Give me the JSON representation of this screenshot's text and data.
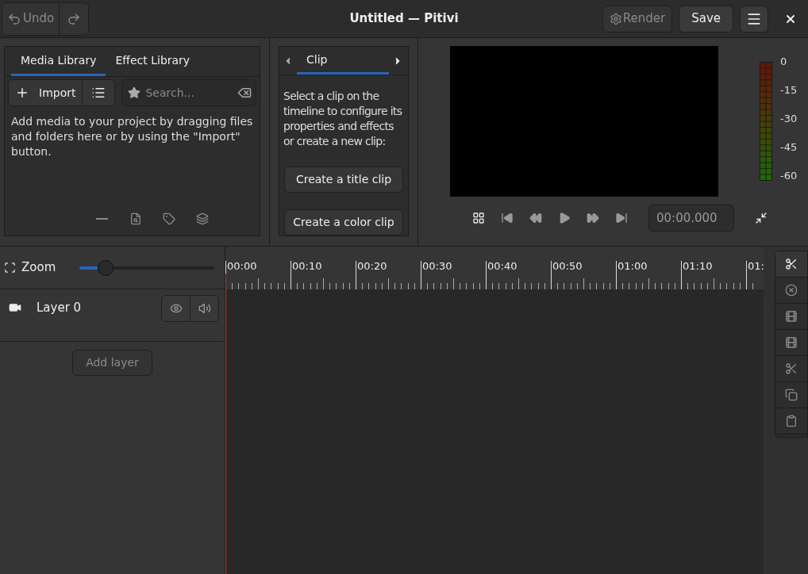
{
  "header": {
    "undo": {
      "label": "Undo",
      "disabled": true
    },
    "redo": {
      "disabled": true
    },
    "title": "Untitled — Pitivi",
    "render": {
      "label": "Render",
      "disabled": true
    },
    "save": {
      "label": "Save"
    }
  },
  "library": {
    "tabs": [
      {
        "label": "Media Library",
        "selected": true
      },
      {
        "label": "Effect Library",
        "selected": false
      }
    ],
    "import": "Import",
    "search": {
      "placeholder": "Search..."
    },
    "hint": "Add media to your project by dragging files and folders here or by using the \"Import\" button.",
    "actions": [
      {
        "kind": "remove",
        "disabled": true
      },
      {
        "kind": "preview",
        "disabled": true
      },
      {
        "kind": "tag",
        "disabled": true
      },
      {
        "kind": "proxy",
        "disabled": true
      }
    ]
  },
  "clip_panel": {
    "tabs": [
      {
        "label": "Clip",
        "selected": true
      }
    ],
    "hint": "Select a clip on the timeline to configure its properties and effects or create a new clip:",
    "buttons": [
      "Create a title clip",
      "Create a color clip"
    ]
  },
  "viewer": {
    "meter_labels": [
      "0",
      "-15",
      "-30",
      "-45",
      "-60"
    ],
    "timecode": "00:00.000"
  },
  "timeline": {
    "zoom": {
      "label": "Zoom",
      "level": 0.19
    },
    "ruler": [
      "00:00",
      "00:10",
      "00:20",
      "00:30",
      "00:40",
      "00:50",
      "01:00",
      "01:10",
      "01:"
    ],
    "layers": [
      {
        "name": "Layer 0"
      }
    ],
    "add_layer": {
      "label": "Add layer",
      "disabled": true
    },
    "tools": [
      {
        "kind": "split",
        "disabled": false
      },
      {
        "kind": "delete",
        "disabled": true
      },
      {
        "kind": "ungroup",
        "disabled": true
      },
      {
        "kind": "group",
        "disabled": true
      },
      {
        "kind": "cut",
        "disabled": true
      },
      {
        "kind": "copy",
        "disabled": true
      },
      {
        "kind": "paste",
        "disabled": true
      }
    ]
  }
}
